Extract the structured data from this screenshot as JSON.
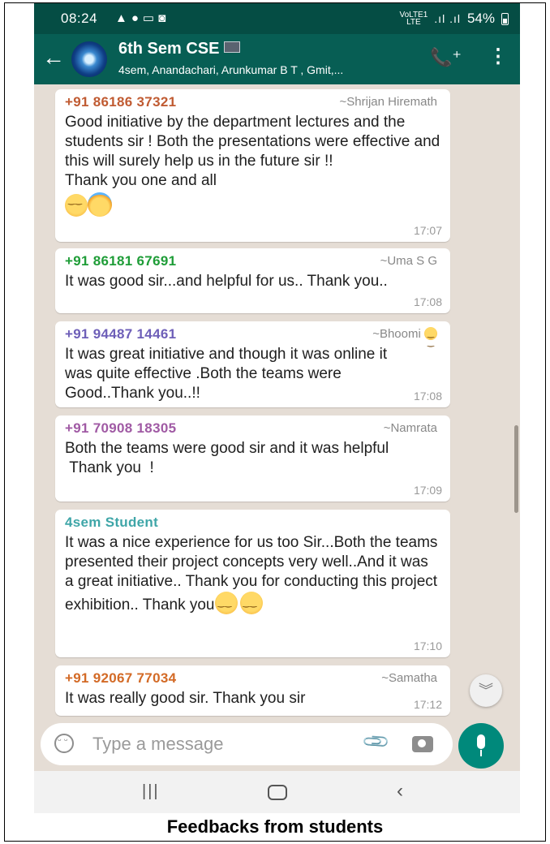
{
  "status_bar": {
    "time": "08:24",
    "network_label_top": "VoLTE1",
    "network_label_bottom": "LTE",
    "battery": "54%"
  },
  "header": {
    "title": "6th Sem CSE",
    "subtitle": "4sem, Anandachari, Arunkumar B T , Gmit,..."
  },
  "messages": [
    {
      "sender": "+91 86186 37321",
      "alias": "~Shrijan Hiremath",
      "sender_color": "#c05b32",
      "text": "Good initiative by the department lectures and the students sir ! Both the presentations were effective and this will surely help us in the future sir !!\nThank you one and all",
      "time": "17:07"
    },
    {
      "sender": "+91 86181 67691",
      "alias": "~Uma S G",
      "sender_color": "#1f9d38",
      "text": "It was good sir...and helpful for us.. Thank you..",
      "time": "17:08"
    },
    {
      "sender": "+91 94487 14461",
      "alias": "~Bhoomi",
      "sender_color": "#6e5fb8",
      "text": "It was great initiative and though it was online it was quite effective .Both the teams were Good..Thank you..!!",
      "time": "17:08"
    },
    {
      "sender": "+91 70908 18305",
      "alias": "~Namrata",
      "sender_color": "#a05aa4",
      "text": "Both the teams were good sir and it was helpful\n Thank you  !",
      "time": "17:09"
    },
    {
      "sender": "4sem Student",
      "alias": "",
      "sender_color": "#3fa6a8",
      "text": "It was a nice experience for us too Sir...Both the teams presented their project concepts very well..And it was a great initiative.. Thank you for conducting this project exhibition.. Thank you",
      "time": "17:10"
    },
    {
      "sender": "+91 92067 77034",
      "alias": "~Samatha",
      "sender_color": "#d36a26",
      "text": "It was really good sir. Thank you sir",
      "time": "17:12"
    }
  ],
  "input": {
    "placeholder": "Type a message"
  },
  "caption": "Feedbacks from students",
  "colors": {
    "appbar": "#075e54",
    "statusbar": "#054d44",
    "chat_background": "#e5ddd5",
    "mic_button": "#00897b"
  },
  "icons": [
    "back-arrow-icon",
    "add-call-icon",
    "more-vert-icon",
    "emoji-icon",
    "attach-icon",
    "camera-icon",
    "mic-icon",
    "scroll-down-icon"
  ]
}
